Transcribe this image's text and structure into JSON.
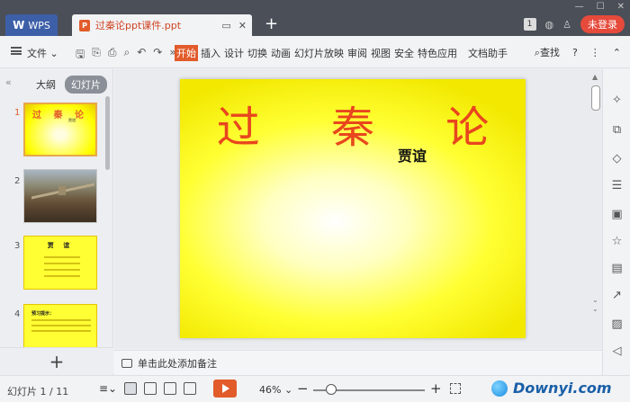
{
  "titlebar": {
    "app_tab": "WPS",
    "doc_tab": "过秦论ppt课件.ppt",
    "login": "未登录",
    "badge": "1"
  },
  "menubar": {
    "file": "文件",
    "tabs": [
      "开始",
      "插入",
      "设计",
      "切换",
      "动画",
      "幻灯片放映",
      "审阅",
      "视图",
      "安全",
      "特色应用",
      "文档助手"
    ],
    "search": "查找",
    "help": "?"
  },
  "leftpanel": {
    "tab_outline": "大纲",
    "tab_slides": "幻灯片",
    "thumbnails": [
      {
        "num": "1",
        "title": "过 秦 论",
        "sub": "贾谊"
      },
      {
        "num": "2"
      },
      {
        "num": "3",
        "title": "贾 谊"
      },
      {
        "num": "4",
        "title": "预习提示："
      }
    ],
    "add": "+"
  },
  "slide": {
    "title": "过 秦 论",
    "subtitle": "贾谊"
  },
  "notes": {
    "placeholder": "单击此处添加备注"
  },
  "status": {
    "slide_count": "幻灯片 1 / 11",
    "zoom": "46%",
    "zoom_value": 0.16
  },
  "watermark": {
    "text": "Downyi.com"
  },
  "colors": {
    "accent": "#e25b2b",
    "titlebar": "#4a4f58",
    "slide_title": "#e8461e"
  }
}
